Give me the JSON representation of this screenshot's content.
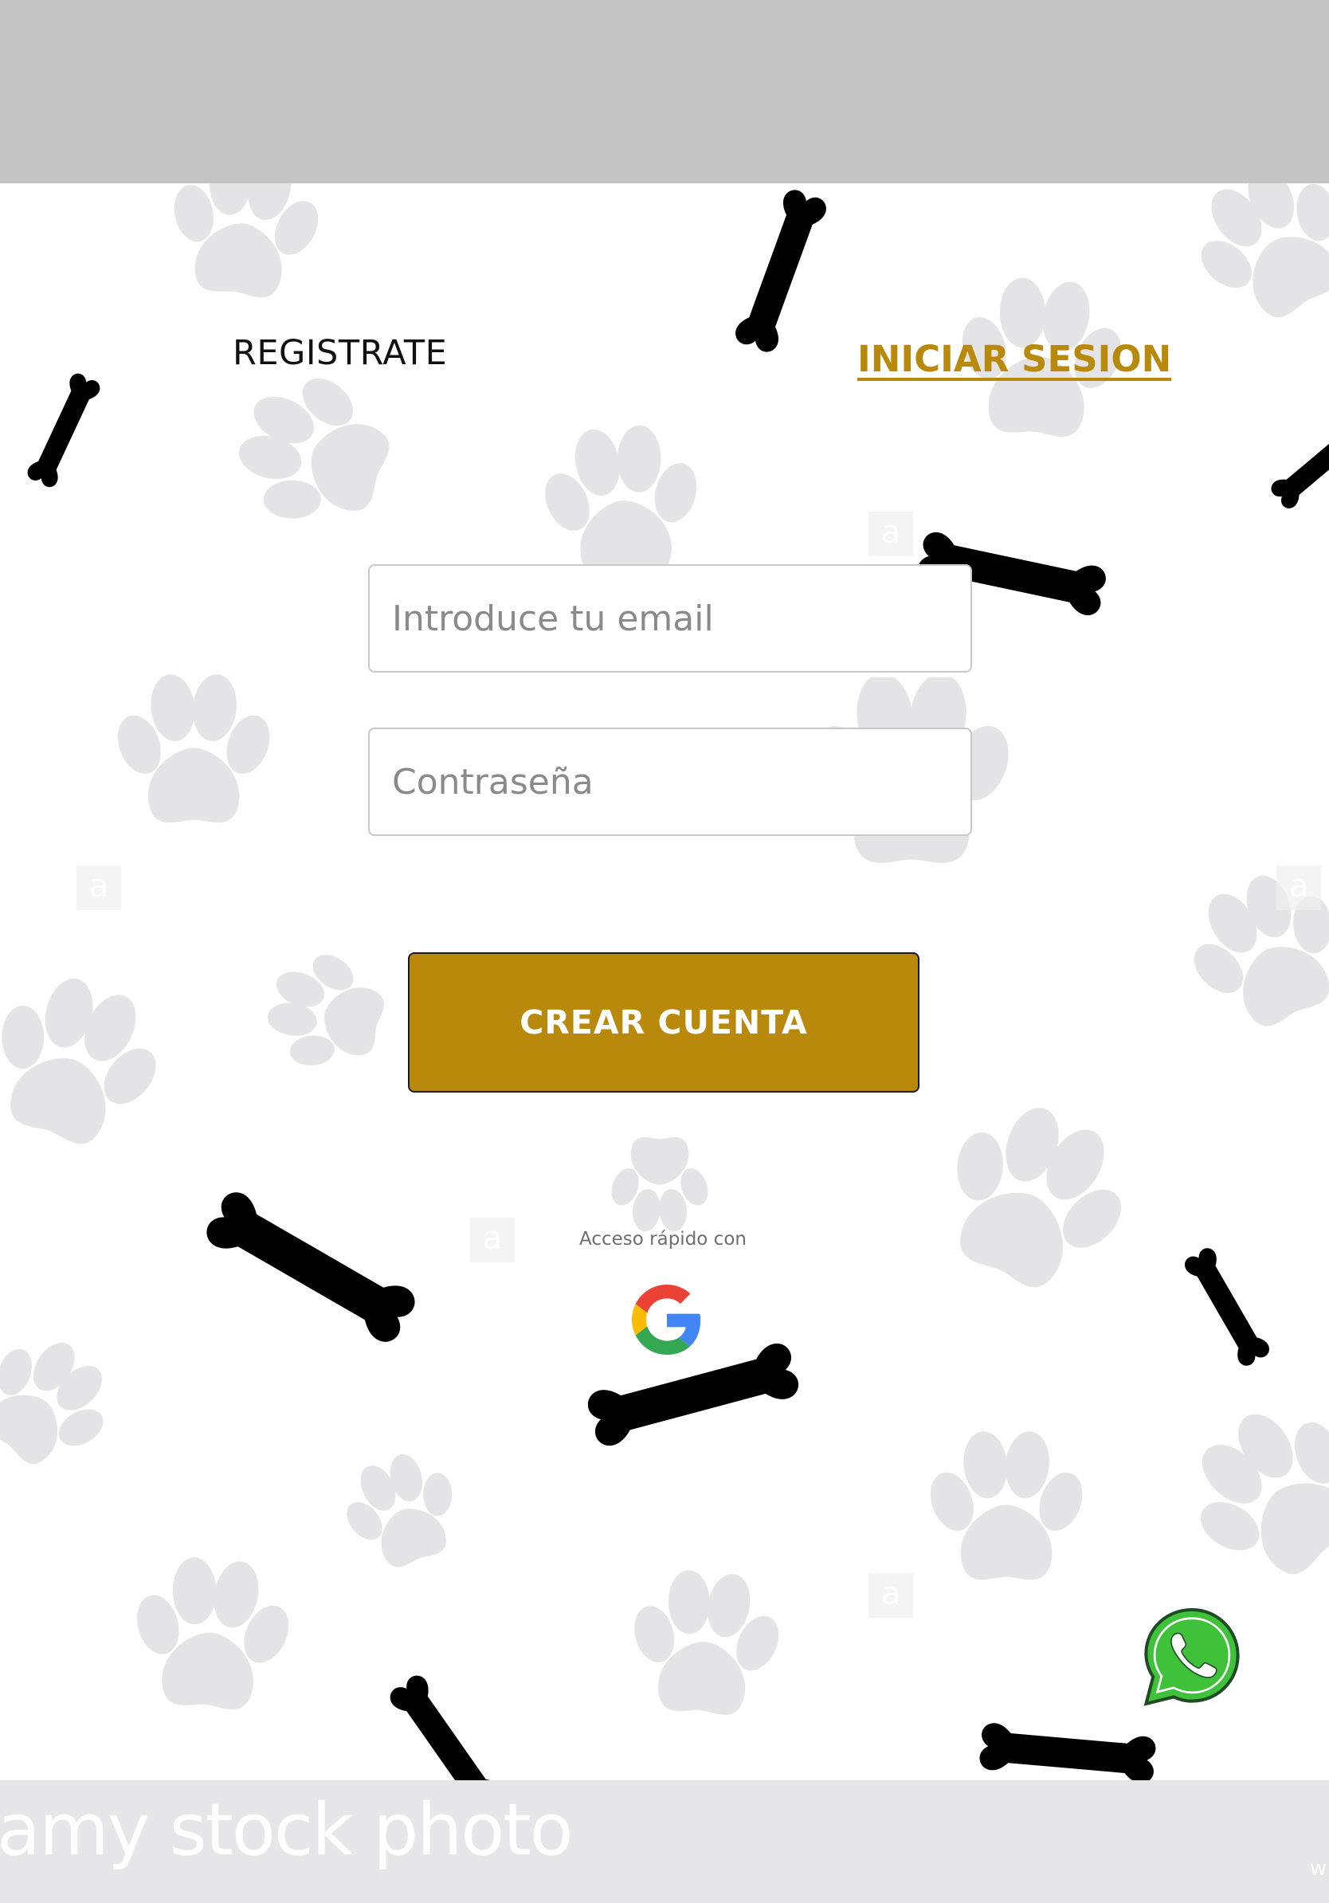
{
  "tabs": {
    "register": "REGISTRATE",
    "login": "INICIAR SESION"
  },
  "form": {
    "email_placeholder": "Introduce tu email",
    "email_value": "",
    "password_placeholder": "Contraseña",
    "password_value": "",
    "submit_label": "CREAR CUENTA"
  },
  "quick_access": {
    "label": "Acceso rápido con",
    "provider_icon": "google-icon"
  },
  "floating": {
    "icon": "whatsapp-icon"
  },
  "watermark": {
    "text": "amy stock photo",
    "corner": "w"
  },
  "colors": {
    "accent": "#b8890a",
    "header_bar": "#c4c4c4",
    "footer_bar": "#e6e6e8",
    "whatsapp": "#3fc23a"
  }
}
